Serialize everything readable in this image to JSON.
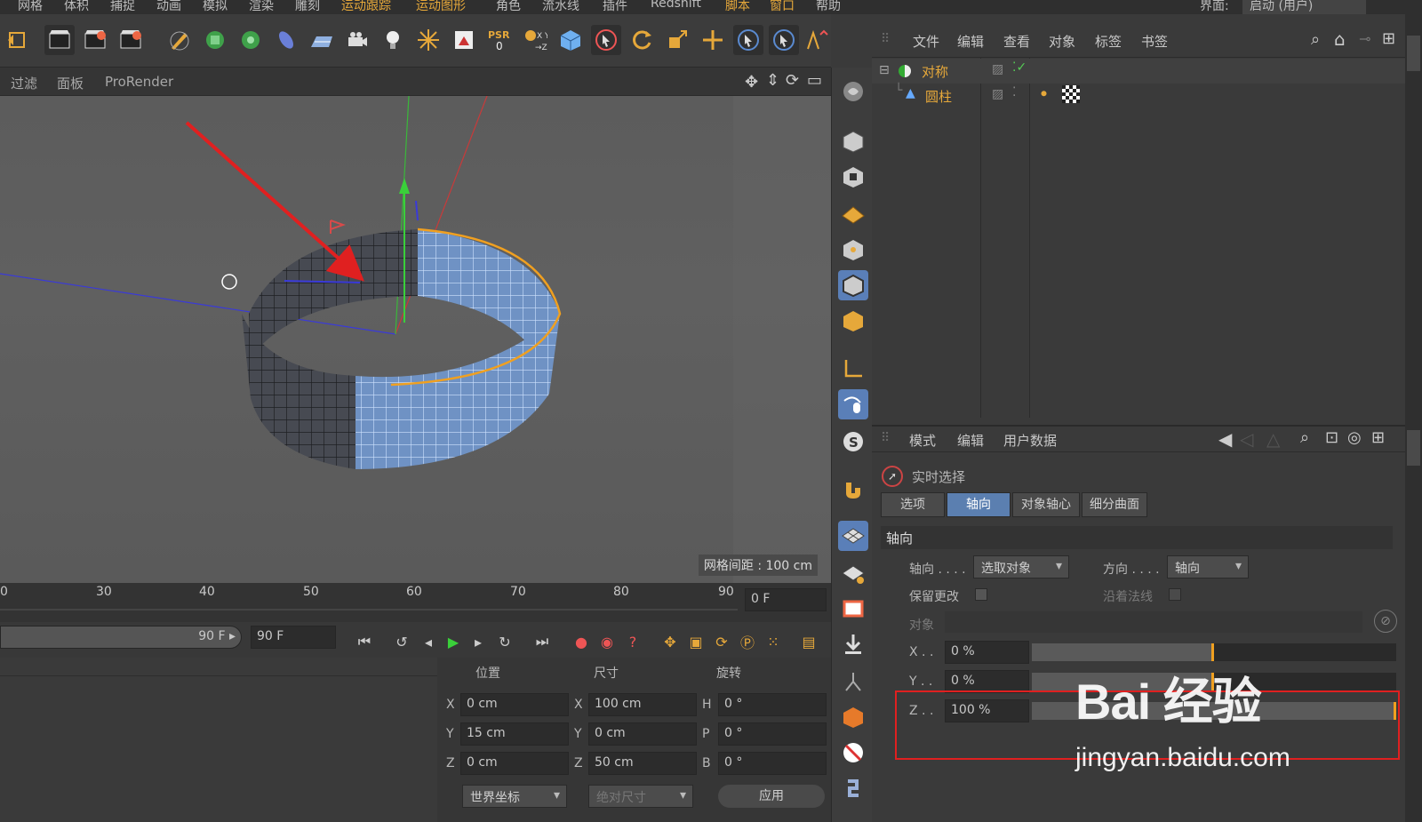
{
  "menubar": {
    "items": [
      "网格",
      "体积",
      "捕捉",
      "动画",
      "模拟",
      "渲染",
      "雕刻",
      "运动跟踪",
      "运动图形",
      "角色",
      "流水线",
      "插件",
      "Redshift",
      "脚本",
      "窗口",
      "帮助"
    ],
    "layout_label": "界面:",
    "layout_value": "启动 (用户)"
  },
  "viewport_menu": {
    "items": [
      "过滤",
      "面板",
      "ProRender"
    ]
  },
  "viewport": {
    "grid_spacing": "网格间距 : 100 cm"
  },
  "timeline": {
    "ticks": [
      "0",
      "30",
      "40",
      "50",
      "60",
      "70",
      "80",
      "90"
    ],
    "current_frame": "0 F"
  },
  "playbar": {
    "end_frame_a": "90 F",
    "end_frame_b": "90 F"
  },
  "coords": {
    "headers": {
      "position": "位置",
      "size": "尺寸",
      "rotation": "旋转"
    },
    "position": [
      {
        "axis": "X",
        "value": "0 cm"
      },
      {
        "axis": "Y",
        "value": "15 cm"
      },
      {
        "axis": "Z",
        "value": "0 cm"
      }
    ],
    "size": [
      {
        "axis": "X",
        "value": "100 cm"
      },
      {
        "axis": "Y",
        "value": "0 cm"
      },
      {
        "axis": "Z",
        "value": "50 cm"
      }
    ],
    "rotation": [
      {
        "axis": "H",
        "value": "0 °"
      },
      {
        "axis": "P",
        "value": "0 °"
      },
      {
        "axis": "B",
        "value": "0 °"
      }
    ],
    "coord_mode": "世界坐标",
    "size_mode": "绝对尺寸",
    "apply": "应用"
  },
  "object_manager": {
    "menu": [
      "文件",
      "编辑",
      "查看",
      "对象",
      "标签",
      "书签"
    ],
    "objects": [
      {
        "name": "对称",
        "color": "#e6a83a"
      },
      {
        "name": "圆柱",
        "color": "#e6a83a"
      }
    ]
  },
  "attributes": {
    "menu": [
      "模式",
      "编辑",
      "用户数据"
    ],
    "tool_name": "实时选择",
    "tabs": [
      "选项",
      "轴向",
      "对象轴心",
      "细分曲面"
    ],
    "active_tab": "轴向",
    "section": "轴向",
    "axis_label": "轴向 . . . .",
    "axis_value": "选取对象",
    "dir_label": "方向 . . . .",
    "dir_value": "轴向",
    "keep_label": "保留更改",
    "normal_label": "沿着法线",
    "object_label": "对象",
    "x_label": "X . .",
    "x_value": "0 %",
    "x_level": 0.5,
    "y_label": "Y . .",
    "y_value": "0 %",
    "y_level": 0.5,
    "z_label": "Z . .",
    "z_value": "100 %",
    "z_level": 1.0
  },
  "watermark": {
    "logo": "Bai 经验",
    "url": "jingyan.baidu.com"
  },
  "colors": {
    "accent": "#e6a83a",
    "active_tab": "#5b7fb0",
    "highlight_box": "#e02020",
    "mesh_selected": "#7fb0ea"
  }
}
